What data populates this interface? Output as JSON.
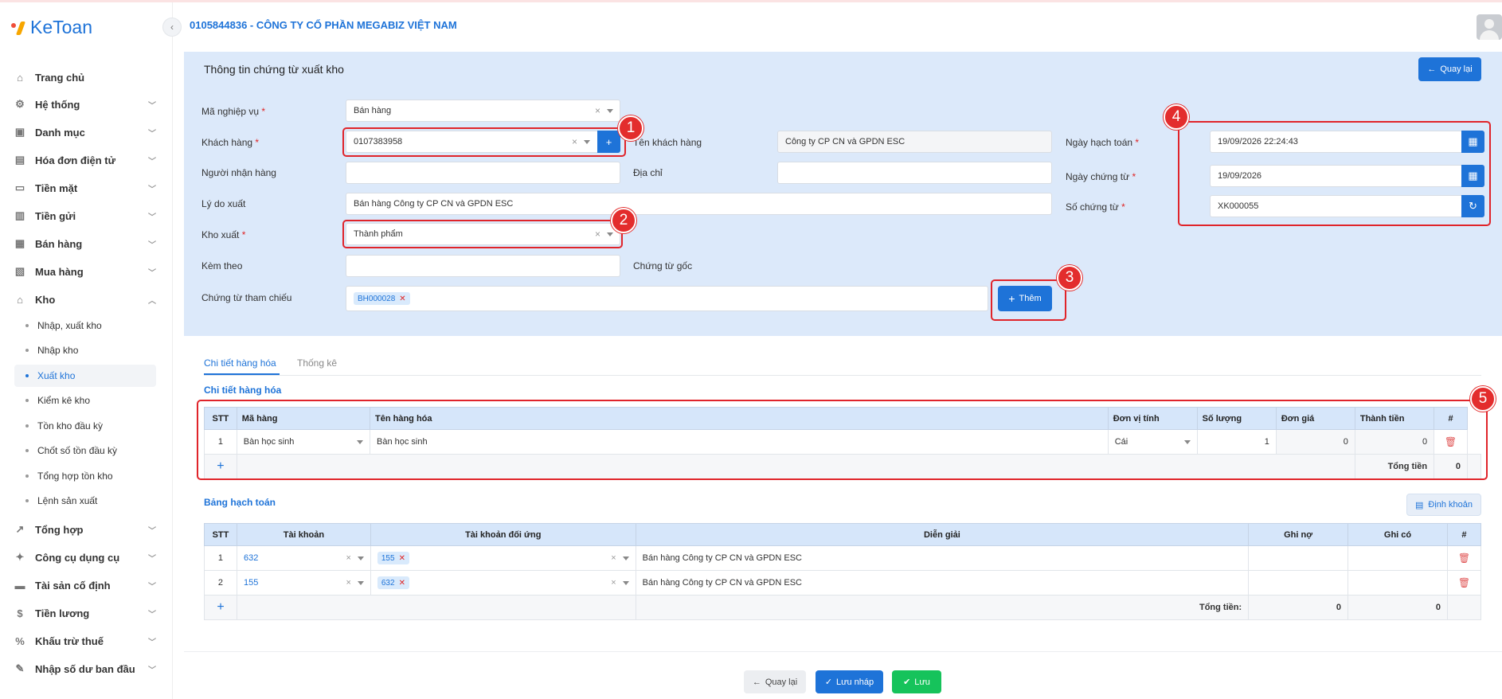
{
  "app": {
    "logo_text": "KeToan",
    "company": "0105844836 - CÔNG TY CỔ PHẦN MEGABIZ VIỆT NAM"
  },
  "sidebar": {
    "items": [
      {
        "label": "Trang chủ",
        "icon": "home-icon"
      },
      {
        "label": "Hệ thống",
        "icon": "gear-icon"
      },
      {
        "label": "Danh mục",
        "icon": "catalog-icon"
      },
      {
        "label": "Hóa đơn điện tử",
        "icon": "invoice-icon"
      },
      {
        "label": "Tiền mặt",
        "icon": "cash-icon"
      },
      {
        "label": "Tiền gửi",
        "icon": "bank-icon"
      },
      {
        "label": "Bán hàng",
        "icon": "sales-icon"
      },
      {
        "label": "Mua hàng",
        "icon": "purchase-icon"
      },
      {
        "label": "Kho",
        "icon": "warehouse-icon"
      }
    ],
    "kho_sub": [
      "Nhập, xuất kho",
      "Nhập kho",
      "Xuất kho",
      "Kiểm kê kho",
      "Tồn kho đầu kỳ",
      "Chốt số tồn đầu kỳ",
      "Tổng hợp tồn kho",
      "Lệnh sản xuất"
    ],
    "items_after": [
      {
        "label": "Tổng hợp",
        "icon": "chart-icon"
      },
      {
        "label": "Công cụ dụng cụ",
        "icon": "tools-icon"
      },
      {
        "label": "Tài sản cố định",
        "icon": "asset-icon"
      },
      {
        "label": "Tiền lương",
        "icon": "salary-icon"
      },
      {
        "label": "Khấu trừ thuế",
        "icon": "tax-icon"
      },
      {
        "label": "Nhập số dư ban đầu",
        "icon": "edit-icon"
      }
    ]
  },
  "form": {
    "title": "Thông tin chứng từ xuất kho",
    "back_label": "Quay lại",
    "ma_nghiep_vu_label": "Mã nghiệp vụ",
    "ma_nghiep_vu": "Bán hàng",
    "khach_hang_label": "Khách hàng",
    "khach_hang": "0107383958",
    "ten_kh_label": "Tên khách hàng",
    "ten_kh": "Công ty CP CN và GPDN ESC",
    "nguoi_nhan_label": "Người nhận hàng",
    "dia_chi_label": "Địa chỉ",
    "ly_do_label": "Lý do xuất",
    "ly_do": "Bán hàng Công ty CP CN và GPDN ESC",
    "kho_xuat_label": "Kho xuất",
    "kho_xuat": "Thành phẩm",
    "kem_theo_label": "Kèm theo",
    "chung_tu_goc_label": "Chứng từ gốc",
    "tham_chieu_label": "Chứng từ tham chiếu",
    "tham_chieu_tag": "BH000028",
    "them_label": "Thêm",
    "ngay_hach_toan_label": "Ngày hạch toán",
    "ngay_hach_toan": "19/09/2026 22:24:43",
    "ngay_chung_tu_label": "Ngày chứng từ",
    "ngay_chung_tu": "19/09/2026",
    "so_chung_tu_label": "Số chứng từ",
    "so_chung_tu": "XK000055"
  },
  "badges": [
    "1",
    "2",
    "3",
    "4",
    "5"
  ],
  "tabs": [
    "Chi tiết hàng hóa",
    "Thống kê"
  ],
  "goods": {
    "section_title": "Chi tiết hàng hóa",
    "headers": [
      "STT",
      "Mã hàng",
      "Tên hàng hóa",
      "Đơn vị tính",
      "Số lượng",
      "Đơn giá",
      "Thành tiền",
      "#"
    ],
    "row": {
      "stt": "1",
      "ma": "Bàn học sinh",
      "ten": "Bàn học sinh",
      "dvt": "Cái",
      "sl": "1",
      "dg": "0",
      "tt": "0"
    },
    "total_label": "Tổng tiền",
    "total": "0"
  },
  "accounting": {
    "section_title": "Bảng hạch toán",
    "dinh_khoan_label": "Định khoản",
    "headers": [
      "STT",
      "Tài khoản",
      "Tài khoản đối ứng",
      "Diễn giải",
      "Ghi nợ",
      "Ghi có",
      "#"
    ],
    "rows": [
      {
        "stt": "1",
        "tk": "632",
        "doi_ung": "155",
        "dien_giai": "Bán hàng Công ty CP CN và GPDN ESC"
      },
      {
        "stt": "2",
        "tk": "155",
        "doi_ung": "632",
        "dien_giai": "Bán hàng Công ty CP CN và GPDN ESC"
      }
    ],
    "total_label": "Tổng tiền:",
    "total_no": "0",
    "total_co": "0"
  },
  "footer": {
    "back": "Quay lại",
    "draft": "Lưu nháp",
    "save": "Lưu"
  },
  "colors": {
    "primary": "#1e73d8",
    "success": "#16c35b",
    "callout": "#e0242a",
    "panel": "#dce9fa"
  }
}
